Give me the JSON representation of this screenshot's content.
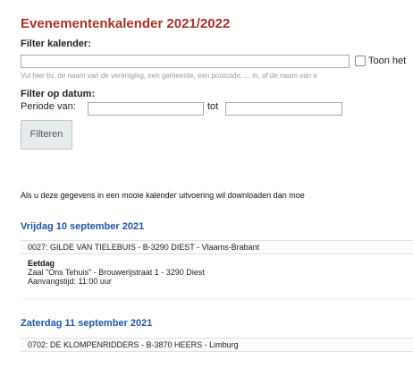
{
  "page": {
    "title": "Evenementenkalender 2021/2022"
  },
  "filter_kalender": {
    "label": "Filter kalender:",
    "input_value": "",
    "checkbox_label": "Toon het",
    "hint": "Vul hier bv. de naam van de vereniging, een gemeente, een postcode, ... in, of de naam van e"
  },
  "filter_datum": {
    "label": "Filter op datum:",
    "periode_label": "Periode van:",
    "from_value": "",
    "tot_label": "tot",
    "to_value": ""
  },
  "filter_button": {
    "label": "Filteren"
  },
  "intro_text": "Als u deze gegevens in een mooie kalender uitvoering wil downloaden dan moe",
  "days": [
    {
      "date": "Vrijdag 10 september 2021",
      "events": [
        {
          "header": "0027: GILDE VAN TIELEBUIS - B-3290 DIEST - Vlaams-Brabant",
          "type": "Eetdag",
          "location": "Zaal \"Ons Tehuis\" - Brouwerijstraat 1 - 3290 Diest",
          "start": "Aanvangstijd: 11:00 uur"
        }
      ]
    },
    {
      "date": "Zaterdag 11 september 2021",
      "events": [
        {
          "header": "0702: DE KLOMPENRIDDERS - B-3870 HEERS - Limburg"
        }
      ]
    }
  ],
  "colors": {
    "title": "#a8322b",
    "day_heading": "#1f56a8",
    "button_bg": "#e6ebec"
  }
}
